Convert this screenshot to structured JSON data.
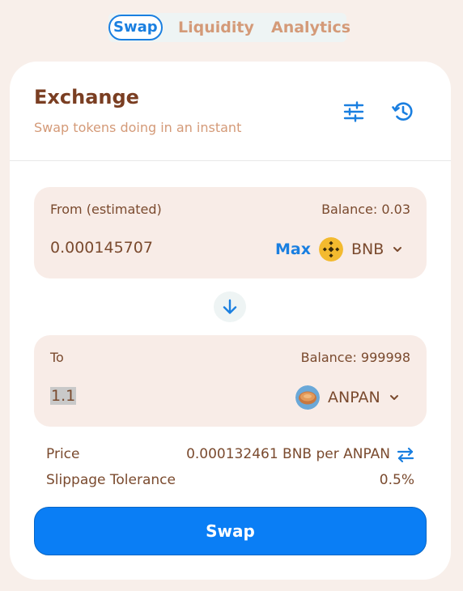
{
  "nav": {
    "tabs": [
      {
        "label": "Swap",
        "active": true
      },
      {
        "label": "Liquidity",
        "active": false
      },
      {
        "label": "Analytics",
        "active": false
      }
    ]
  },
  "header": {
    "title": "Exchange",
    "subtitle": "Swap tokens doing in an instant",
    "settings_icon": "sliders-icon",
    "history_icon": "history-icon"
  },
  "from": {
    "label": "From (estimated)",
    "balance": "Balance: 0.03",
    "amount": "0.000145707",
    "max_label": "Max",
    "token": "BNB"
  },
  "to": {
    "label": "To",
    "balance": "Balance: 999998",
    "amount": "1.1",
    "token": "ANPAN"
  },
  "info": {
    "price_label": "Price",
    "price_value": "0.000132461 BNB per ANPAN",
    "slippage_label": "Slippage Tolerance",
    "slippage_value": "0.5%"
  },
  "action": {
    "swap_label": "Swap"
  },
  "colors": {
    "accent": "#0a7ef5",
    "background": "#f8efea",
    "panel": "#f8ece7",
    "text": "#7a4a2e",
    "muted": "#d49a78"
  }
}
